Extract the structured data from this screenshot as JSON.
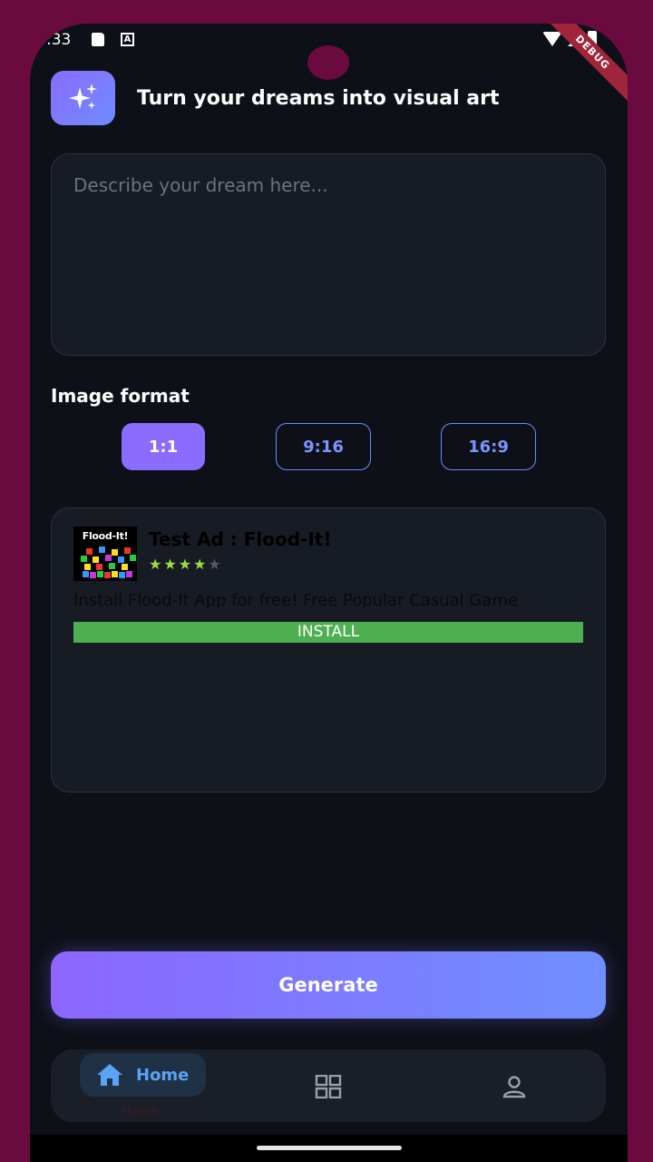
{
  "status_bar": {
    "time": ":33",
    "debug_label": "DEBUG"
  },
  "header": {
    "title": "Turn your dreams into visual art",
    "logo_icon": "sparkles-icon"
  },
  "prompt": {
    "placeholder": "Describe your dream here...",
    "value": ""
  },
  "image_format": {
    "label": "Image format",
    "options": [
      {
        "label": "1:1",
        "selected": true
      },
      {
        "label": "9:16",
        "selected": false
      },
      {
        "label": "16:9",
        "selected": false
      }
    ]
  },
  "ad": {
    "brand": "Flood-It!",
    "title": "Test Ad : Flood-It!",
    "rating": 4,
    "rating_max": 5,
    "description": "Install Flood-It App for free! Free Popular Casual Game",
    "install_label": "INSTALL"
  },
  "generate_label": "Generate",
  "bottom_nav": {
    "home_label": "Home",
    "items": [
      {
        "name": "home",
        "icon": "home-icon",
        "active": true
      },
      {
        "name": "gallery",
        "icon": "grid-icon",
        "active": false
      },
      {
        "name": "profile",
        "icon": "person-icon",
        "active": false
      }
    ]
  },
  "colors": {
    "accent": "#8b6cff",
    "accent_secondary": "#6d8cff",
    "background": "#0d1017",
    "card": "#171b23",
    "install": "#4caf50",
    "nav_active": "#5ba3f5"
  }
}
